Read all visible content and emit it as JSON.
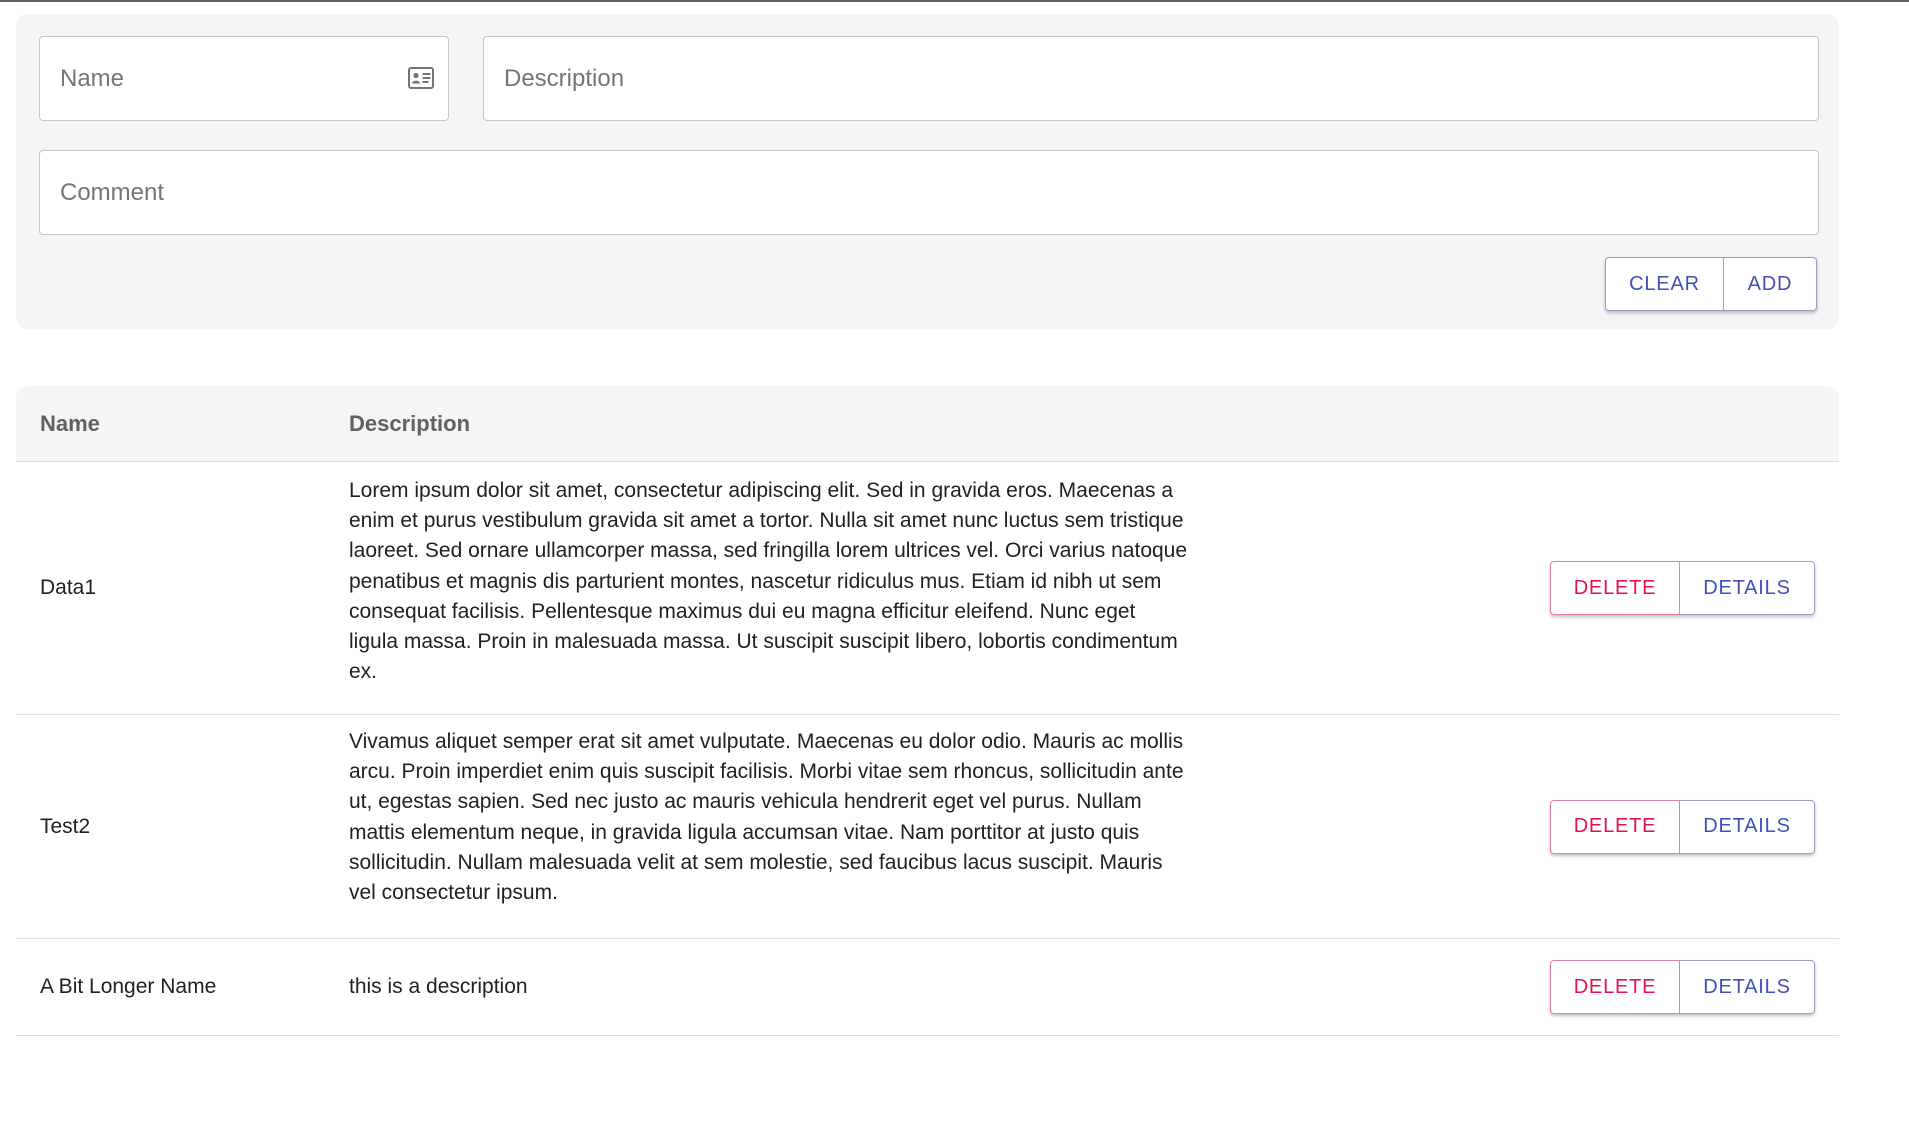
{
  "form": {
    "name_placeholder": "Name",
    "name_value": "",
    "description_placeholder": "Description",
    "description_value": "",
    "comment_placeholder": "Comment",
    "comment_value": "",
    "name_icon": "contact-card-icon",
    "clear_label": "CLEAR",
    "add_label": "ADD"
  },
  "table": {
    "headers": {
      "name": "Name",
      "description": "Description"
    },
    "rows": [
      {
        "name": "Data1",
        "description": "Lorem ipsum dolor sit amet, consectetur adipiscing elit. Sed in gravida eros. Maecenas a enim et purus vestibulum gravida sit amet a tortor. Nulla sit amet nunc luctus sem tristique laoreet. Sed ornare ullamcorper massa, sed fringilla lorem ultrices vel. Orci varius natoque penatibus et magnis dis parturient montes, nascetur ridiculus mus. Etiam id nibh ut sem consequat facilisis. Pellentesque maximus dui eu magna efficitur eleifend. Nunc eget ligula massa. Proin in malesuada massa. Ut suscipit suscipit libero, lobortis condimentum ex.",
        "delete_label": "DELETE",
        "details_label": "DETAILS"
      },
      {
        "name": "Test2",
        "description": "Vivamus aliquet semper erat sit amet vulputate. Maecenas eu dolor odio. Mauris ac mollis arcu. Proin imperdiet enim quis suscipit facilisis. Morbi vitae sem rhoncus, sollicitudin ante ut, egestas sapien. Sed nec justo ac mauris vehicula hendrerit eget vel purus. Nullam mattis elementum neque, in gravida ligula accumsan vitae. Nam porttitor at justo quis sollicitudin. Nullam malesuada velit at sem molestie, sed faucibus lacus suscipit. Mauris vel consectetur ipsum.",
        "delete_label": "DELETE",
        "details_label": "DETAILS"
      },
      {
        "name": "A Bit Longer Name",
        "description": "this is a description",
        "delete_label": "DELETE",
        "details_label": "DETAILS"
      }
    ]
  },
  "colors": {
    "primary": "#3f51b5",
    "danger": "#e0134e",
    "card_background": "#f5f5f5"
  }
}
